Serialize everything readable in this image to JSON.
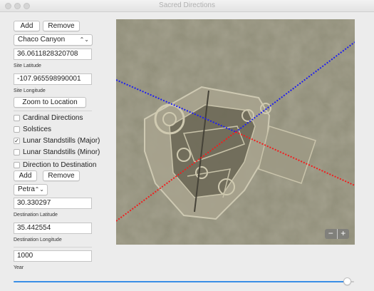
{
  "window": {
    "title": "Sacred Directions"
  },
  "site": {
    "add_label": "Add",
    "remove_label": "Remove",
    "selected": "Chaco Canyon",
    "latitude": "36.0611828320708",
    "latitude_label": "Site Latitude",
    "longitude": "-107.965598990001",
    "longitude_label": "Site Longitude",
    "zoom_label": "Zoom to Location"
  },
  "options": [
    {
      "label": "Cardinal Directions",
      "checked": false
    },
    {
      "label": "Solstices",
      "checked": false
    },
    {
      "label": "Lunar Standstills (Major)",
      "checked": true
    },
    {
      "label": "Lunar Standstills (Minor)",
      "checked": false
    }
  ],
  "destination": {
    "toggle_label": "Direction to Destination",
    "toggle_checked": false,
    "add_label": "Add",
    "remove_label": "Remove",
    "selected": "Petra",
    "latitude": "30.330297",
    "latitude_label": "Destination Latitude",
    "longitude": "35.442554",
    "longitude_label": "Destination Longitude"
  },
  "year": {
    "value": "1000",
    "label": "Year",
    "slider_fraction": 0.98
  },
  "map": {
    "zoom_out": "−",
    "zoom_in": "+"
  },
  "colors": {
    "accent": "#3a8ee6",
    "line_blue": "#1e1ef0",
    "line_red": "#f01e1e"
  }
}
